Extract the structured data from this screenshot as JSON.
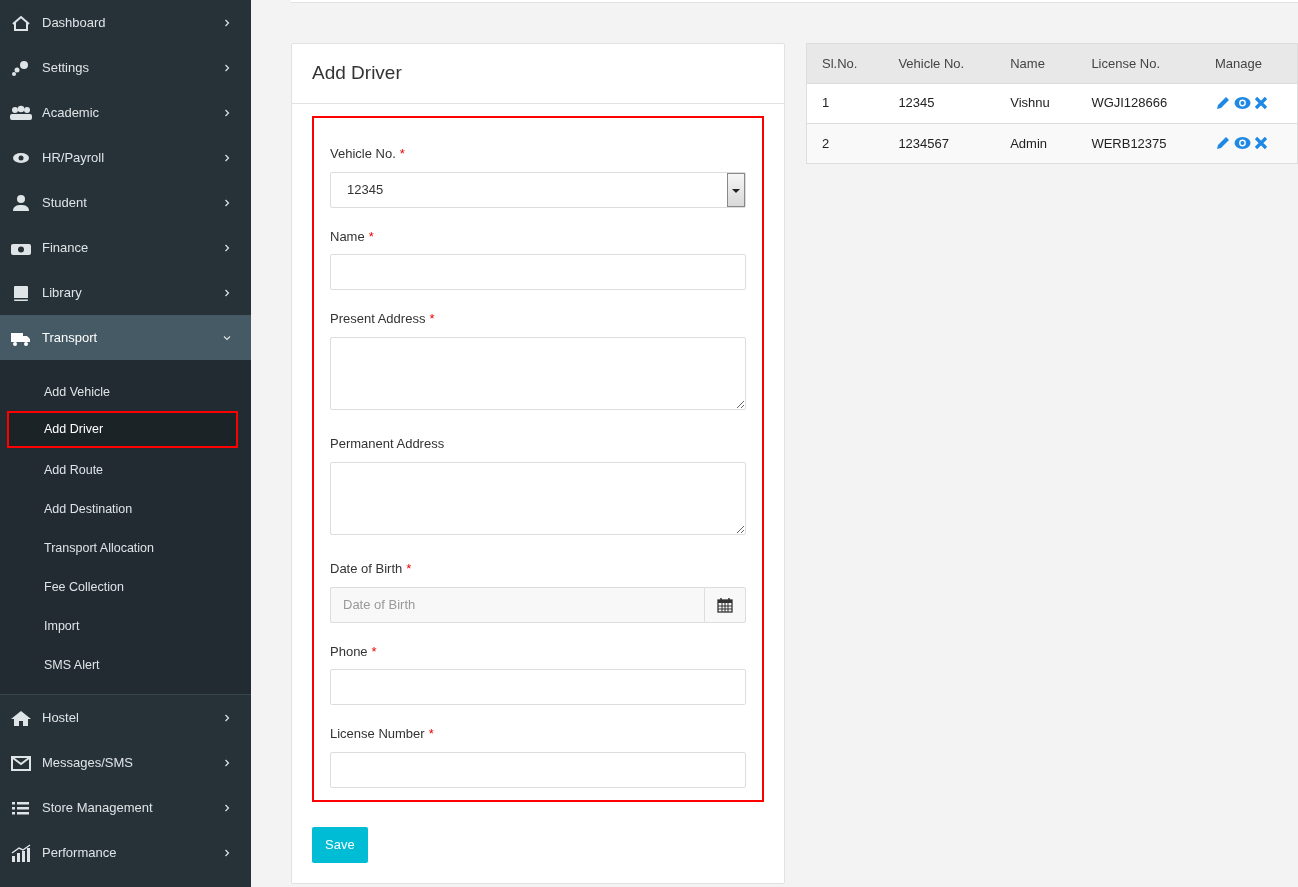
{
  "sidebar": {
    "items": [
      {
        "label": "Dashboard",
        "expanded": false
      },
      {
        "label": "Settings",
        "expanded": false
      },
      {
        "label": "Academic",
        "expanded": false
      },
      {
        "label": "HR/Payroll",
        "expanded": false
      },
      {
        "label": "Student",
        "expanded": false
      },
      {
        "label": "Finance",
        "expanded": false
      },
      {
        "label": "Library",
        "expanded": false
      },
      {
        "label": "Transport",
        "expanded": true,
        "children": [
          {
            "label": "Add Vehicle",
            "selected": false
          },
          {
            "label": "Add Driver",
            "selected": true
          },
          {
            "label": "Add Route",
            "selected": false
          },
          {
            "label": "Add Destination",
            "selected": false
          },
          {
            "label": "Transport Allocation",
            "selected": false
          },
          {
            "label": "Fee Collection",
            "selected": false
          },
          {
            "label": "Import",
            "selected": false
          },
          {
            "label": "SMS Alert",
            "selected": false
          }
        ]
      },
      {
        "label": "Hostel",
        "expanded": false
      },
      {
        "label": "Messages/SMS",
        "expanded": false
      },
      {
        "label": "Store Management",
        "expanded": false
      },
      {
        "label": "Performance",
        "expanded": false
      }
    ]
  },
  "form": {
    "title": "Add Driver",
    "highlighted": true,
    "fields": [
      {
        "kind": "select",
        "label": "Vehicle No.",
        "required_mark": "*",
        "value": "12345"
      },
      {
        "kind": "input",
        "label": "Name",
        "required_mark": "*"
      },
      {
        "kind": "textarea",
        "label": "Present Address",
        "required_mark": "*"
      },
      {
        "kind": "textarea",
        "label": "Permanent Address"
      },
      {
        "kind": "date",
        "label": "Date of Birth",
        "required_mark": "*",
        "placeholder": "Date of Birth"
      },
      {
        "kind": "input",
        "label": "Phone",
        "required_mark": "*"
      },
      {
        "kind": "input",
        "label": "License Number",
        "required_mark": "*"
      }
    ],
    "save_button": "Save"
  },
  "table": {
    "columns": [
      "Sl.No.",
      "Vehicle No.",
      "Name",
      "License No.",
      "Manage"
    ],
    "rows": [
      [
        "1",
        "12345",
        "Vishnu",
        "WGJI128666"
      ],
      [
        "2",
        "1234567",
        "Admin",
        "WERB12375"
      ]
    ]
  }
}
